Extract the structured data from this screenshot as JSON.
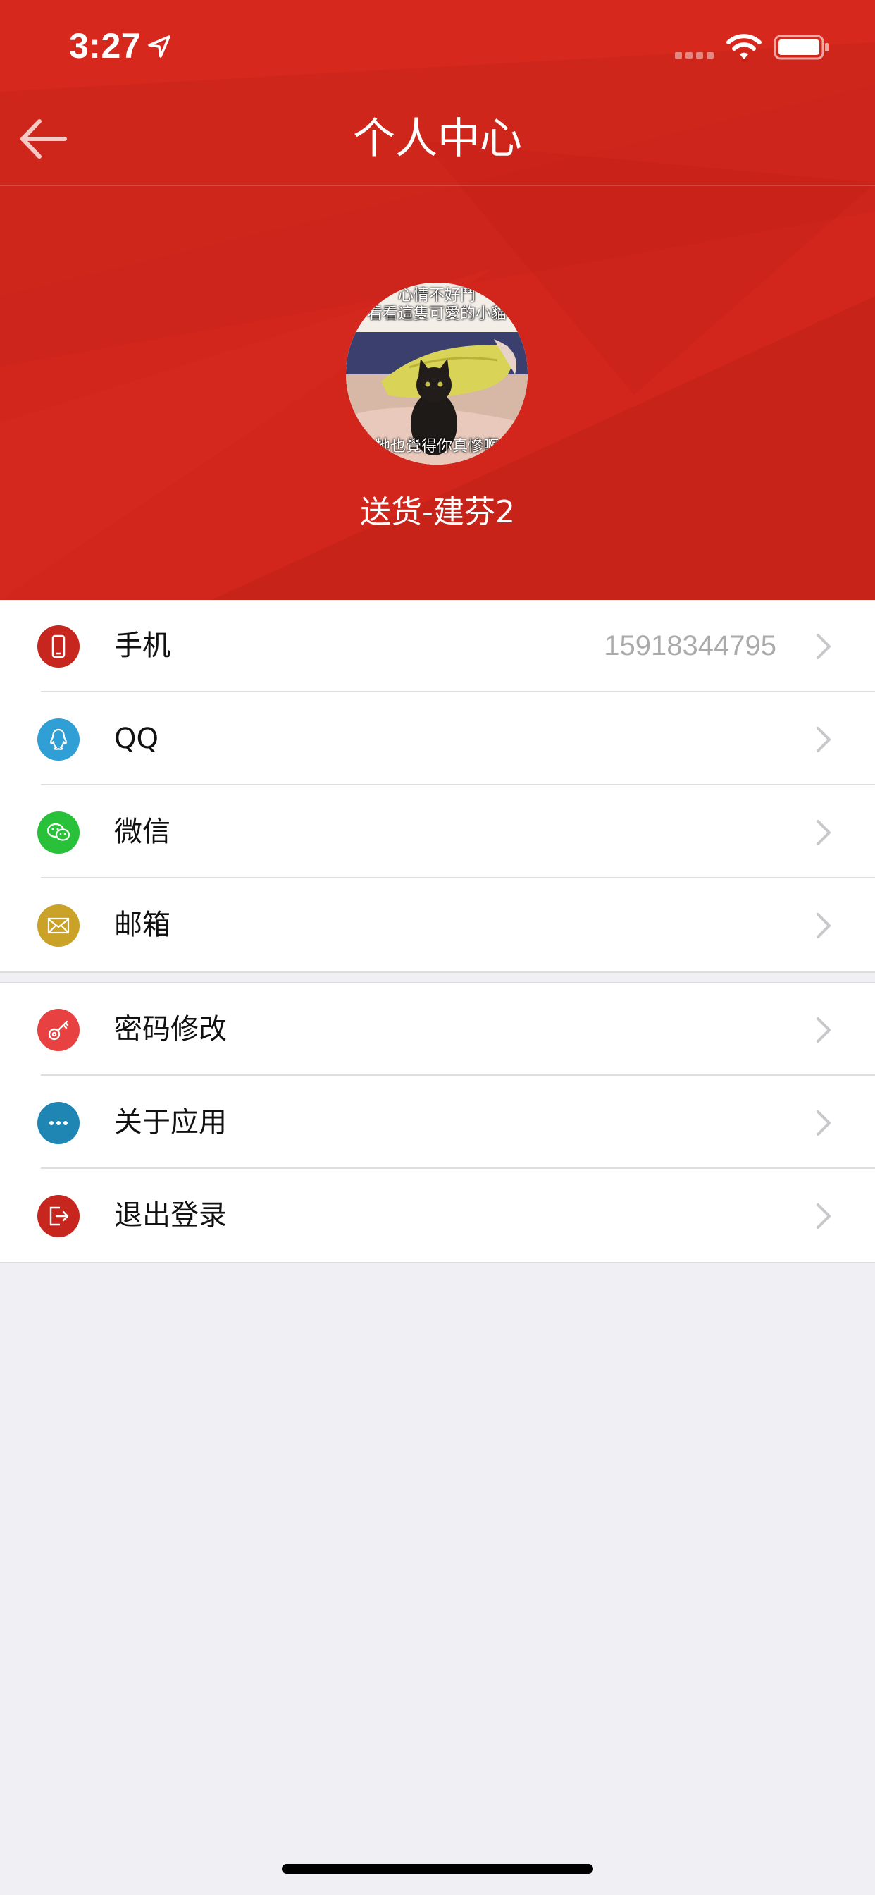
{
  "status_bar": {
    "time": "3:27"
  },
  "nav": {
    "title": "个人中心"
  },
  "profile": {
    "username": "送货-建芬2",
    "avatar_caption_top_1": "心情不好鬥",
    "avatar_caption_top_2": "看看這隻可愛的小貓",
    "avatar_caption_bottom": "牠也覺得你真慘啊"
  },
  "contact_list": [
    {
      "label": "手机",
      "value": "15918344795",
      "icon": "phone-icon",
      "color": "#c6261d"
    },
    {
      "label": "QQ",
      "value": "",
      "icon": "qq-icon",
      "color": "#2f9fd6"
    },
    {
      "label": "微信",
      "value": "",
      "icon": "wechat-icon",
      "color": "#29c13a"
    },
    {
      "label": "邮箱",
      "value": "",
      "icon": "mail-icon",
      "color": "#c9a227"
    }
  ],
  "settings_list": [
    {
      "label": "密码修改",
      "icon": "key-icon",
      "color": "#e74141"
    },
    {
      "label": "关于应用",
      "icon": "more-icon",
      "color": "#1f86b4"
    },
    {
      "label": "退出登录",
      "icon": "logout-icon",
      "color": "#c6261d"
    }
  ],
  "colors": {
    "header_red": "#d2261c",
    "page_background": "#efeff4",
    "value_gray": "#aaaaaa",
    "chevron_gray": "#c7c7cc"
  }
}
